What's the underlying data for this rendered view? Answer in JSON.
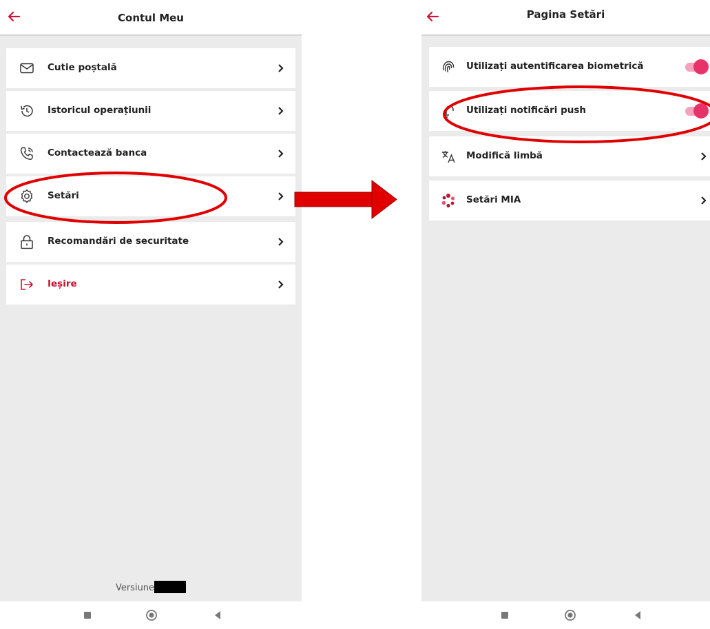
{
  "left": {
    "title": "Contul Meu",
    "items": [
      {
        "label": "Cutie poștală",
        "icon": "mail-icon"
      },
      {
        "label": "Istoricul operațiunii",
        "icon": "history-icon"
      },
      {
        "label": "Contactează banca",
        "icon": "phone-icon"
      },
      {
        "label": "Setări",
        "icon": "gear-icon"
      },
      {
        "label": "Recomandări de securitate",
        "icon": "lock-icon"
      },
      {
        "label": "Ieșire",
        "icon": "logout-icon"
      }
    ],
    "version_label": "Versiune"
  },
  "right": {
    "title": "Pagina Setări",
    "items": [
      {
        "label": "Utilizați autentificarea biometrică",
        "icon": "fingerprint-icon",
        "toggle_on": true
      },
      {
        "label": "Utilizați notificări push",
        "icon": "notification-icon",
        "toggle_on": true
      },
      {
        "label": "Modifică limbă",
        "icon": "translate-icon"
      },
      {
        "label": "Setări MIA",
        "icon": "mia-logo-icon"
      }
    ]
  },
  "colors": {
    "accent_red": "#c8102e",
    "toggle_pink": "#e8336a",
    "annotation_red": "#e00000"
  }
}
